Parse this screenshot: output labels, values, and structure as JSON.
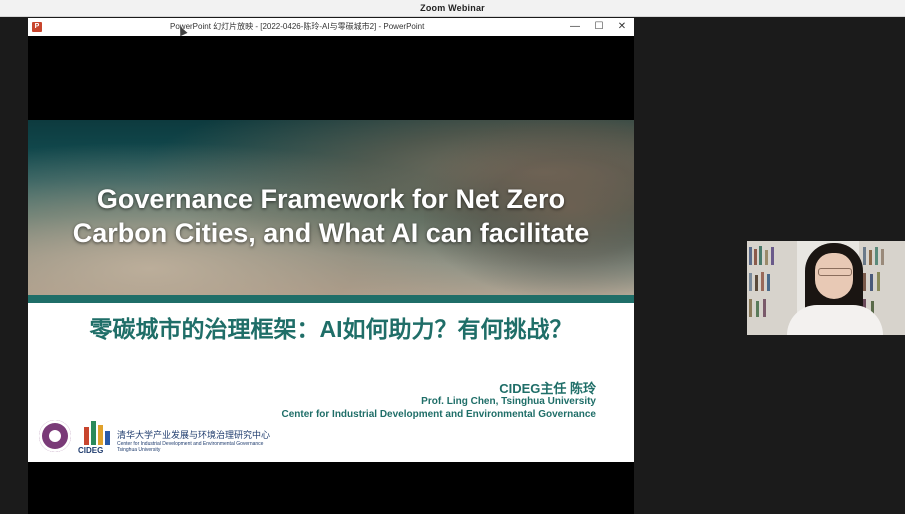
{
  "zoom": {
    "window_title": "Zoom Webinar"
  },
  "ppt": {
    "window_title": "PowerPoint 幻灯片放映 - [2022-0426-陈玲-AI与零碳城市2] - PowerPoint",
    "controls": {
      "minimize": "—",
      "maximize": "☐",
      "close": "✕"
    }
  },
  "slide": {
    "title_en_line1": "Governance Framework for Net Zero",
    "title_en_line2": "Carbon Cities, and What AI can facilitate",
    "title_cn": "零碳城市的治理框架：AI如何助力？有何挑战？",
    "presenter_role": "CIDEG主任   陈玲",
    "presenter_line1": "Prof.  Ling Chen, Tsinghua University",
    "presenter_line2": "Center for Industrial Development and Environmental Governance",
    "logo_text": "CIDEG",
    "org_cn": "清华大学产业发展与环境治理研究中心",
    "org_en_line1": "Center for Industrial Development and Environmental Governance",
    "org_en_line2": "Tsinghua University"
  },
  "colors": {
    "accent": "#1f6e68",
    "logo_purple": "#7a3a78",
    "logo_navy": "#1f3c6e"
  }
}
